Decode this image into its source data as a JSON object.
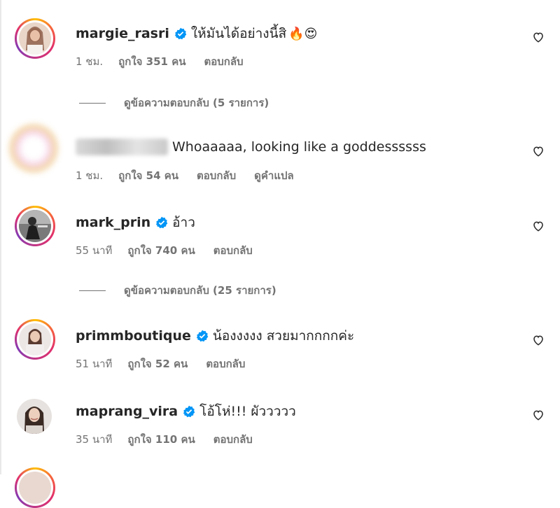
{
  "colors": {
    "verified": "#0095f6",
    "text_primary": "#262626",
    "text_secondary": "#737373"
  },
  "comments": [
    {
      "username": "margie_rasri",
      "verified": true,
      "text": "ให้มันได้อย่างนี้สิ",
      "emojis": "🔥😍",
      "time": "1 ชม.",
      "likes": "ถูกใจ 351 คน",
      "reply": "ตอบกลับ",
      "view_replies": "ดูข้อความตอบกลับ (5 รายการ)"
    },
    {
      "username": "",
      "verified": false,
      "text": "Whoaaaaa, looking like a goddessssss",
      "time": "1 ชม.",
      "likes": "ถูกใจ 54 คน",
      "reply": "ตอบกลับ",
      "translate": "ดูคำแปล"
    },
    {
      "username": "mark_prin",
      "verified": true,
      "text": "อ้าว",
      "time": "55 นาที",
      "likes": "ถูกใจ 740 คน",
      "reply": "ตอบกลับ",
      "view_replies": "ดูข้อความตอบกลับ (25 รายการ)"
    },
    {
      "username": "primmboutique",
      "verified": true,
      "text": "น้องงงงง สวยมากกกกค่ะ",
      "time": "51 นาที",
      "likes": "ถูกใจ 52 คน",
      "reply": "ตอบกลับ"
    },
    {
      "username": "maprang_vira",
      "verified": true,
      "text": "โอ้โห่!!! ผัววววว",
      "time": "35 นาที",
      "likes": "ถูกใจ 110 คน",
      "reply": "ตอบกลับ"
    }
  ]
}
